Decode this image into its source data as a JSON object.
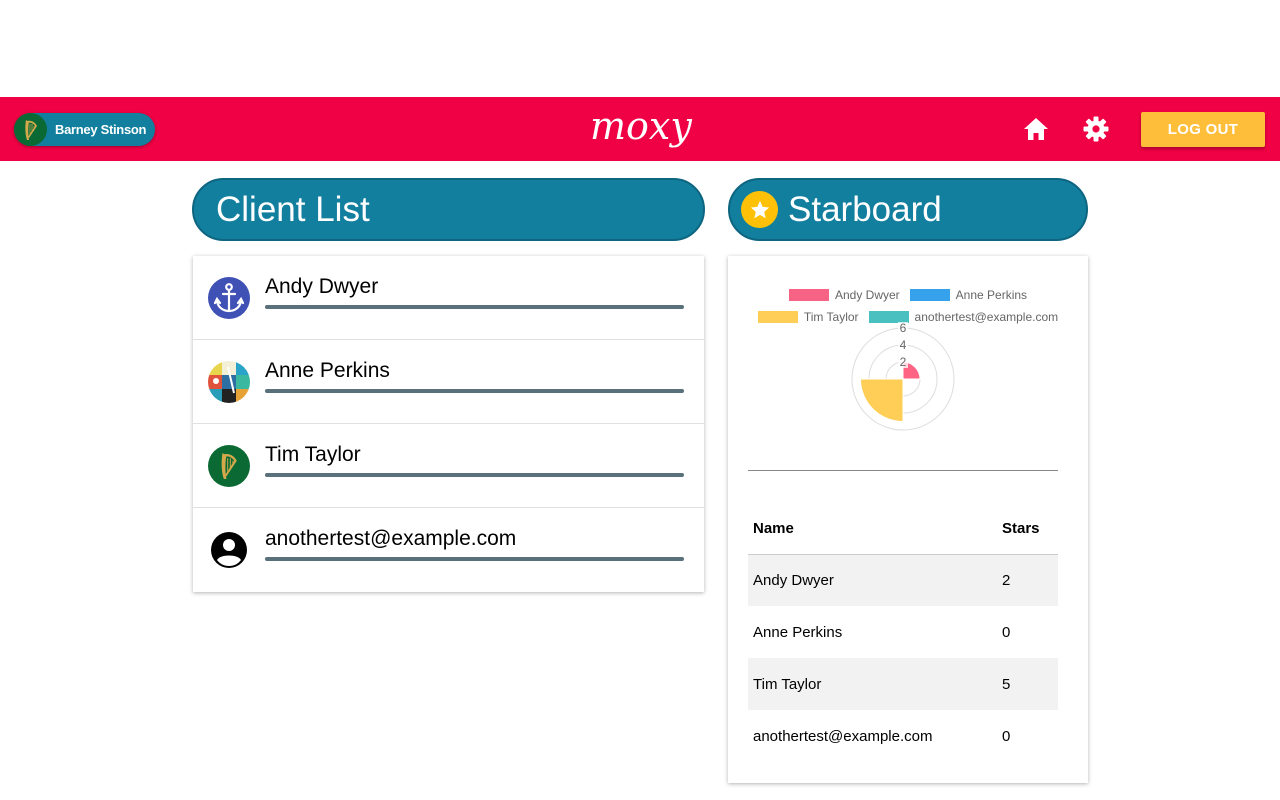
{
  "navbar": {
    "user_name": "Barney Stinson",
    "brand": "moxy",
    "logout_label": "LOG OUT",
    "color": "#f00044"
  },
  "client_list": {
    "title": "Client List",
    "clients": [
      {
        "name": "Andy Dwyer",
        "avatar": "anchor-icon"
      },
      {
        "name": "Anne Perkins",
        "avatar": "pattern-avatar"
      },
      {
        "name": "Tim Taylor",
        "avatar": "harp-icon"
      },
      {
        "name": "anothertest@example.com",
        "avatar": "account-circle-icon"
      }
    ]
  },
  "starboard": {
    "title": "Starboard",
    "table": {
      "headers": [
        "Name",
        "Stars"
      ],
      "rows": [
        [
          "Andy Dwyer",
          "2"
        ],
        [
          "Anne Perkins",
          "0"
        ],
        [
          "Tim Taylor",
          "5"
        ],
        [
          "anothertest@example.com",
          "0"
        ]
      ]
    }
  },
  "chart_data": {
    "type": "polarArea",
    "categories": [
      "Andy Dwyer",
      "Anne Perkins",
      "Tim Taylor",
      "anothertest@example.com"
    ],
    "values": [
      2,
      0,
      5,
      0
    ],
    "colors": [
      "#ff6384",
      "#36a2eb",
      "#ffce56",
      "#4bc0c0"
    ],
    "ticks": [
      "2",
      "4",
      "6"
    ],
    "rlim": [
      0,
      6
    ],
    "legend": "top"
  }
}
